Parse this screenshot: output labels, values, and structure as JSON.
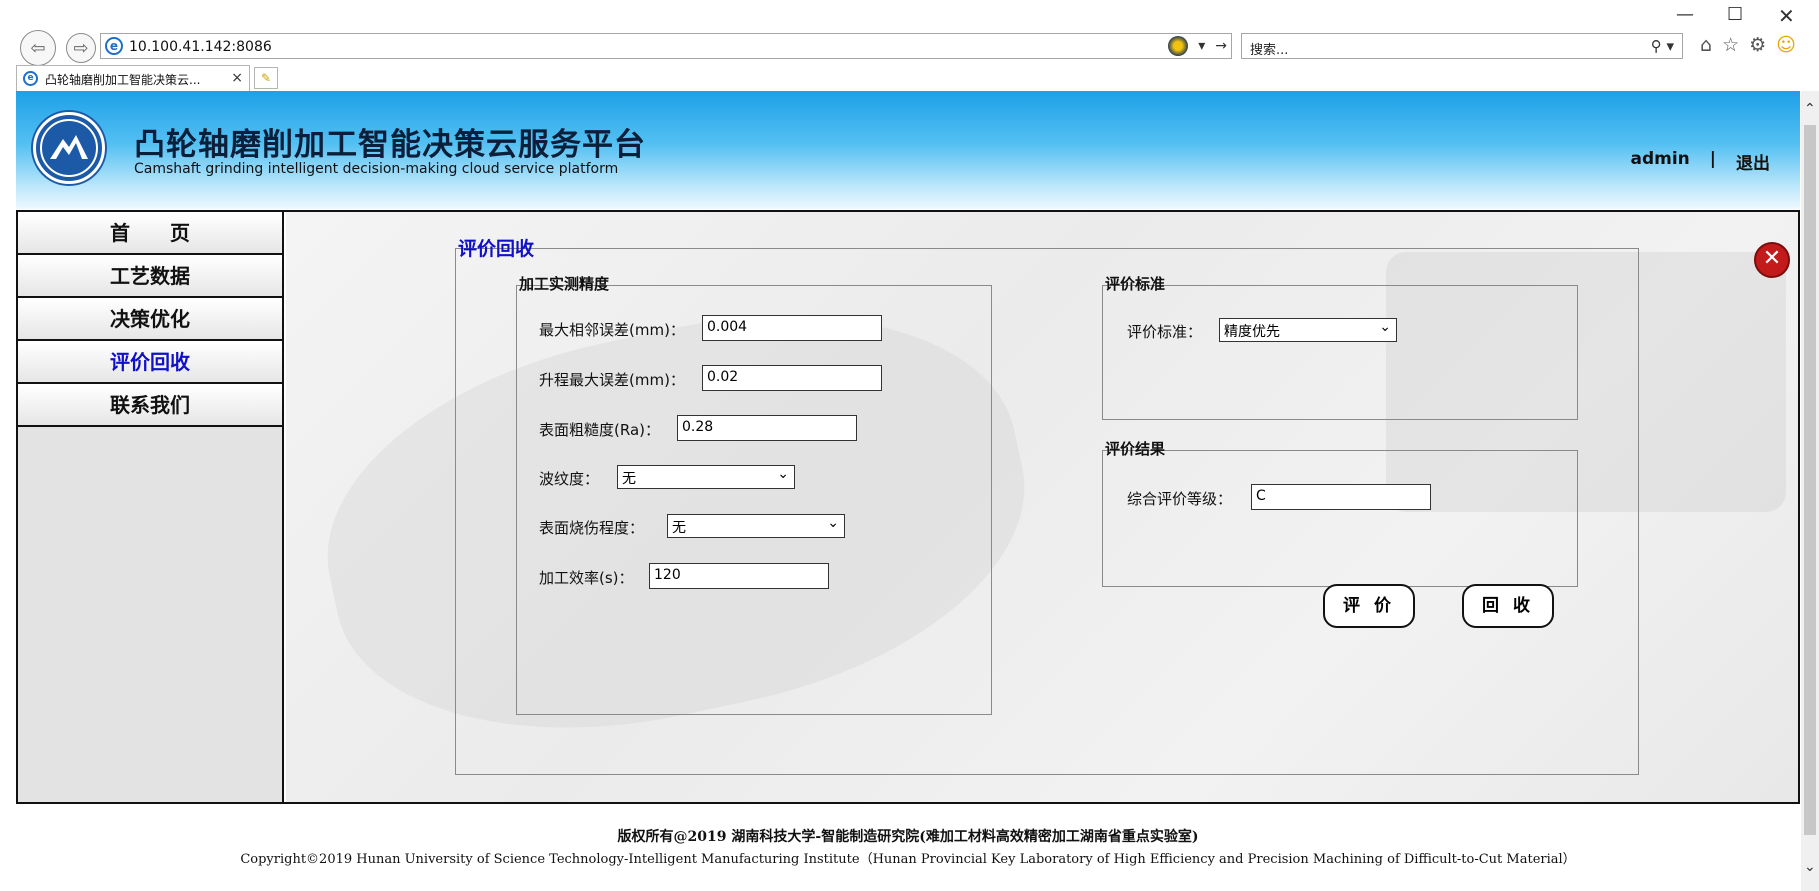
{
  "browser": {
    "url": "10.100.41.142:8086",
    "search_placeholder": "搜索...",
    "tab_title": "凸轮轴磨削加工智能决策云...",
    "window_min": "—",
    "window_max": "☐",
    "window_close": "✕"
  },
  "header": {
    "title": "凸轮轴磨削加工智能决策云服务平台",
    "subtitle": "Camshaft grinding intelligent decision-making cloud service platform",
    "user": "admin",
    "separator": "|",
    "logout": "退出"
  },
  "sidebar": {
    "items": [
      {
        "label": "首　　页",
        "active": false
      },
      {
        "label": "工艺数据",
        "active": false
      },
      {
        "label": "决策优化",
        "active": false
      },
      {
        "label": "评价回收",
        "active": true
      },
      {
        "label": "联系我们",
        "active": false
      }
    ]
  },
  "main": {
    "section_title": "评价回收",
    "measure": {
      "legend": "加工实测精度",
      "max_adjacent_error_label": "最大相邻误差(mm)：",
      "max_adjacent_error_value": "0.004",
      "max_lift_error_label": "升程最大误差(mm)：",
      "max_lift_error_value": "0.02",
      "roughness_label": "表面粗糙度(Ra)：",
      "roughness_value": "0.28",
      "waviness_label": "波纹度：",
      "waviness_value": "无",
      "burn_label": "表面烧伤程度：",
      "burn_value": "无",
      "efficiency_label": "加工效率(s)：",
      "efficiency_value": "120"
    },
    "standard": {
      "legend": "评价标准",
      "label": "评价标准：",
      "value": "精度优先"
    },
    "result": {
      "legend": "评价结果",
      "label": "综合评价等级：",
      "value": "C"
    },
    "evaluate_button": "评 价",
    "recycle_button": "回 收"
  },
  "footer": {
    "line1": "版权所有@2019 湖南科技大学-智能制造研究院(难加工材料高效精密加工湖南省重点实验室)",
    "line2": "Copyright©2019 Hunan University of Science Technology-Intelligent Manufacturing Institute（Hunan Provincial Key Laboratory of High Efficiency and Precision Machining of Difficult-to-Cut Material）"
  }
}
